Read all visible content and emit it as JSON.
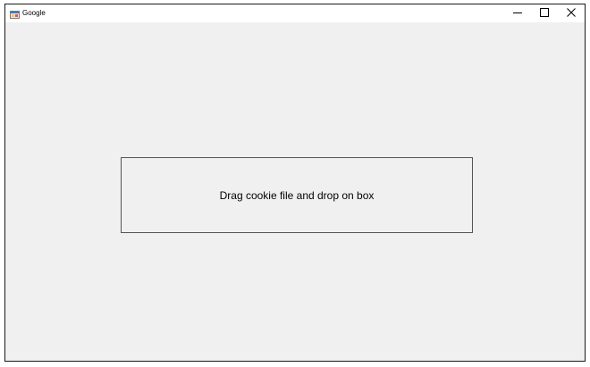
{
  "window": {
    "title": "Google",
    "app_icon": "winforms-app-icon",
    "controls": {
      "minimize_icon": "minimize-icon",
      "maximize_icon": "maximize-icon",
      "close_icon": "close-icon"
    }
  },
  "drop_box": {
    "label": "Drag cookie file and drop on box"
  }
}
